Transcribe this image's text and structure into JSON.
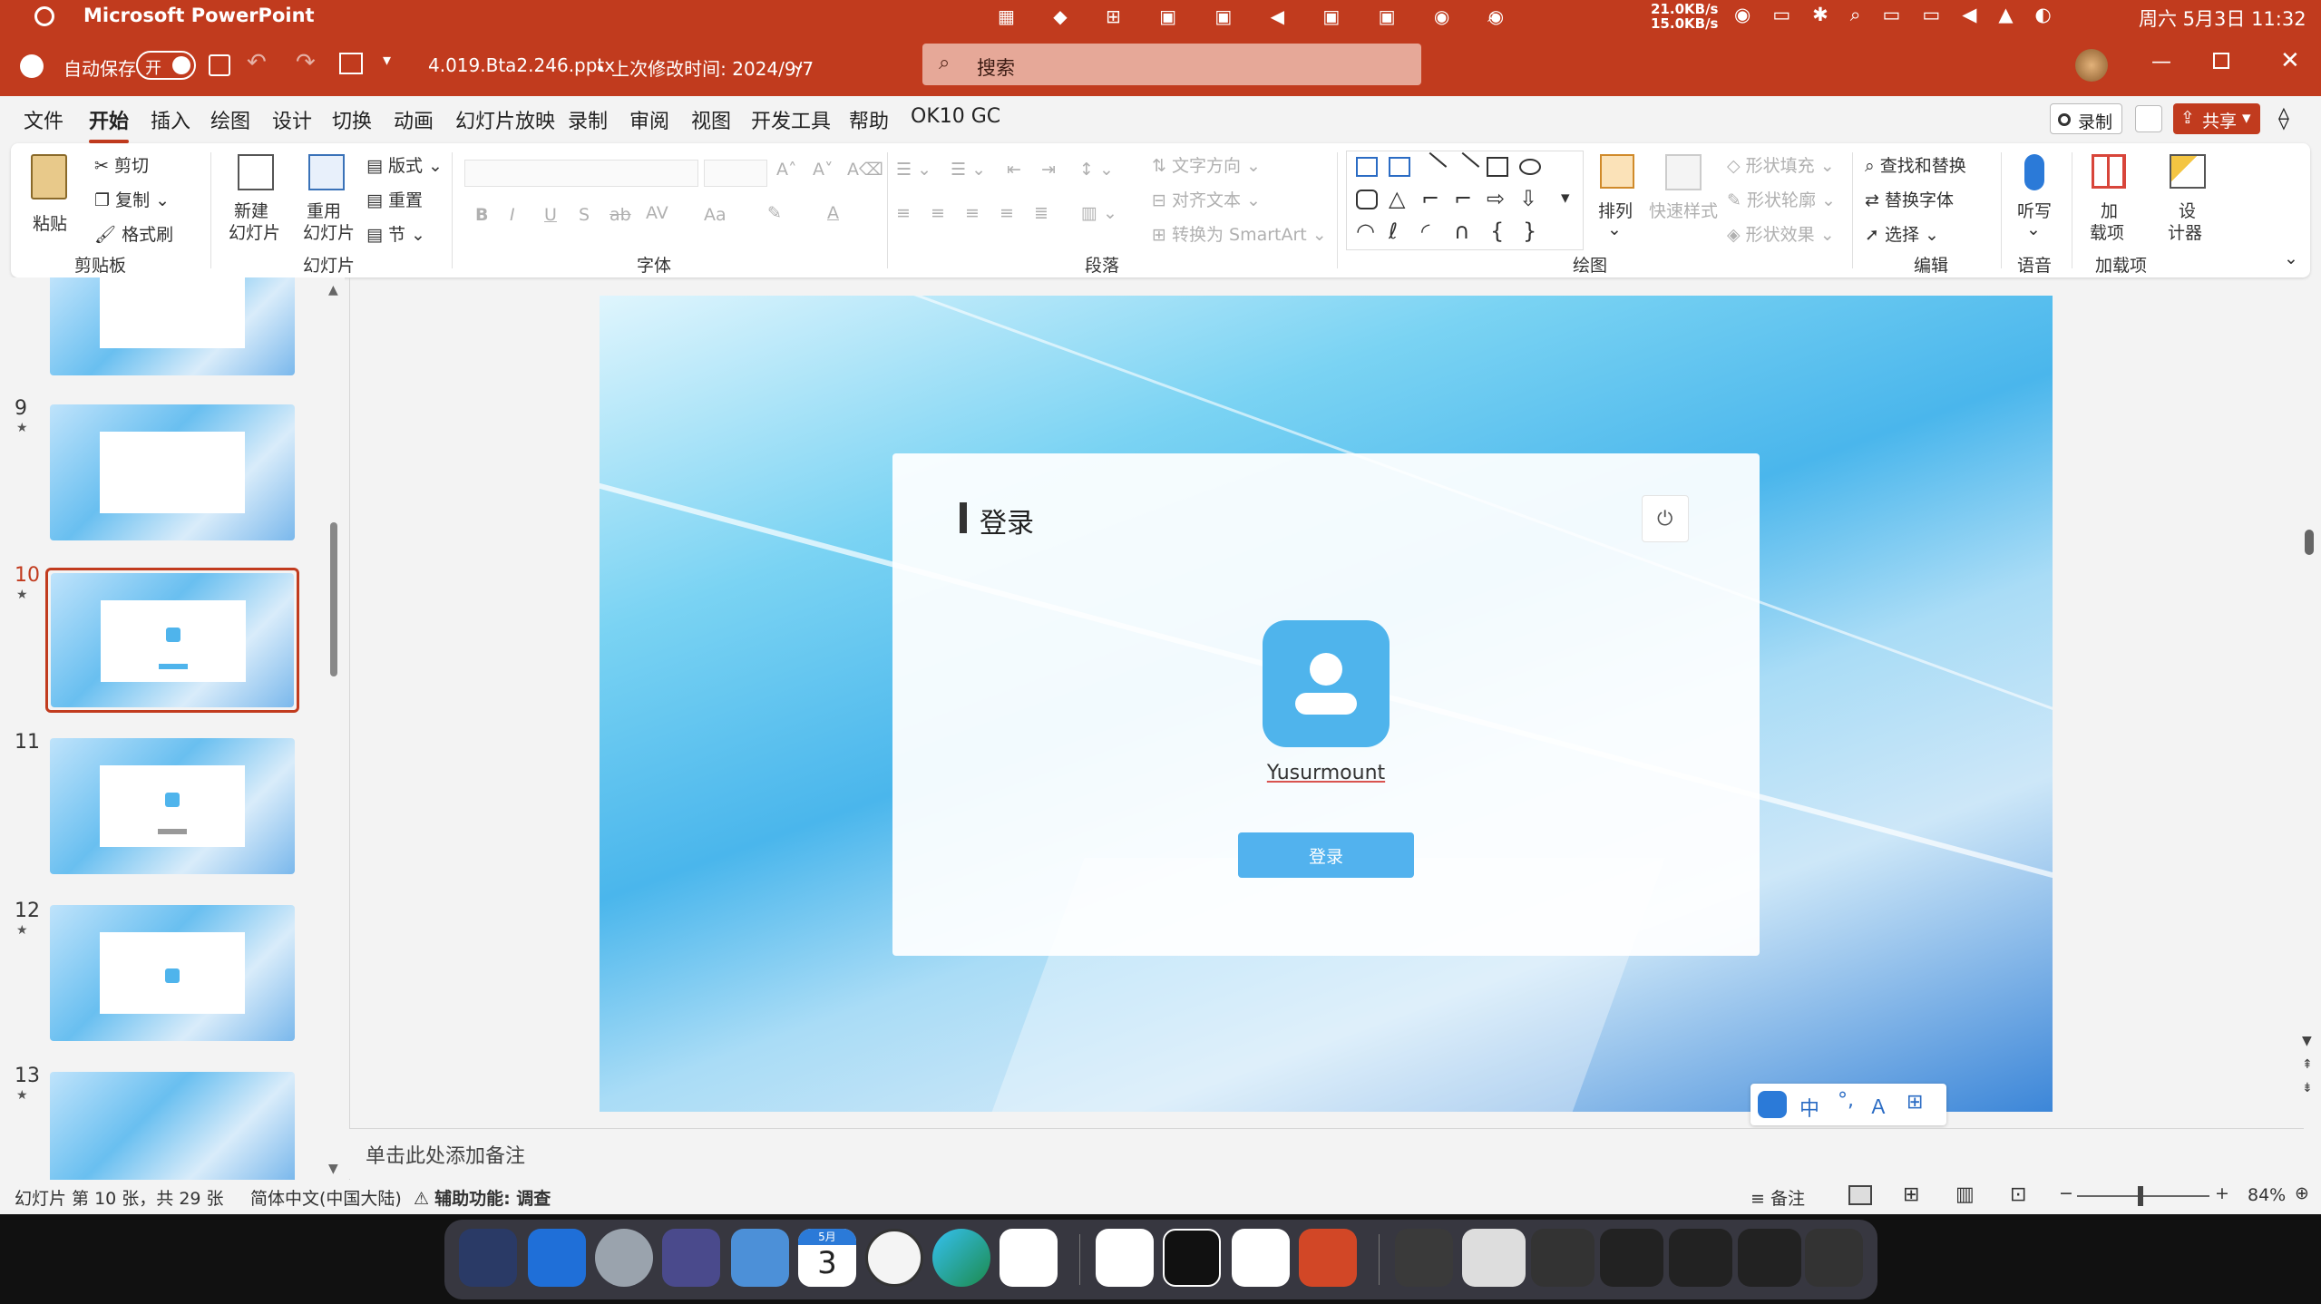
{
  "menubar": {
    "app_name": "Microsoft PowerPoint",
    "net_up": "21.0KB/s",
    "net_down": "15.0KB/s",
    "datetime": "周六 5月3日 11:32"
  },
  "titlebar": {
    "autosave_label": "自动保存",
    "autosave_state": "开",
    "filename": "4.019.Bta2.246.pptx",
    "modified": "• 上次修改时间: 2024/9/7",
    "search_placeholder": "搜索"
  },
  "tabs": [
    "文件",
    "开始",
    "插入",
    "绘图",
    "设计",
    "切换",
    "动画",
    "幻灯片放映",
    "录制",
    "审阅",
    "视图",
    "开发工具",
    "帮助",
    "OK10 GC"
  ],
  "right_buttons": {
    "record": "录制",
    "share": "共享"
  },
  "ribbon": {
    "clipboard": {
      "paste": "粘贴",
      "cut": "剪切",
      "copy": "复制",
      "format_painter": "格式刷",
      "label": "剪贴板"
    },
    "slides": {
      "new_slide": "新建",
      "new_slide_2": "幻灯片",
      "reuse": "重用",
      "reuse_2": "幻灯片",
      "layout": "版式",
      "reset": "重置",
      "section": "节",
      "label": "幻灯片"
    },
    "font": {
      "bold": "B",
      "italic": "I",
      "underline": "U",
      "shadow": "S",
      "strike": "ab",
      "spacing": "AV",
      "case": "Aa",
      "color": "A",
      "label": "字体"
    },
    "paragraph": {
      "text_direction": "文字方向",
      "align_text": "对齐文本",
      "smartart": "转换为 SmartArt",
      "label": "段落"
    },
    "drawing": {
      "arrange": "排列",
      "quick_styles": "快速样式",
      "shape_fill": "形状填充",
      "shape_outline": "形状轮廓",
      "shape_effect": "形状效果",
      "label": "绘图"
    },
    "editing": {
      "find_replace": "查找和替换",
      "replace_font": "替换字体",
      "select": "选择",
      "label": "编辑"
    },
    "voice": {
      "dictate": "听写",
      "label": "语音"
    },
    "addins": {
      "addins": "加",
      "addins_2": "载项",
      "designer": "设",
      "designer_2": "计器",
      "label": "加载项"
    }
  },
  "thumbnails": [
    {
      "num": "9",
      "star": "★"
    },
    {
      "num": "10",
      "star": "★"
    },
    {
      "num": "11",
      "star": ""
    },
    {
      "num": "12",
      "star": "★"
    },
    {
      "num": "13",
      "star": "★"
    }
  ],
  "slide": {
    "login_title": "登录",
    "username": "Yusurmount",
    "login_button": "登录"
  },
  "notes_placeholder": "单击此处添加备注",
  "statusbar": {
    "slide_info": "幻灯片 第 10 张，共 29 张",
    "language": "简体中文(中国大陆)",
    "accessibility": "辅助功能: 调查",
    "notes": "备注",
    "zoom": "84%",
    "zoom_fraction": 0.48
  },
  "ime": {
    "lang": "中",
    "punct": "°,"
  },
  "dock_calendar": {
    "month": "5月",
    "day": "3"
  },
  "colors": {
    "accent": "#c13b1e",
    "login_blue": "#52b2ee",
    "avatar_blue": "#4fb4ec"
  }
}
